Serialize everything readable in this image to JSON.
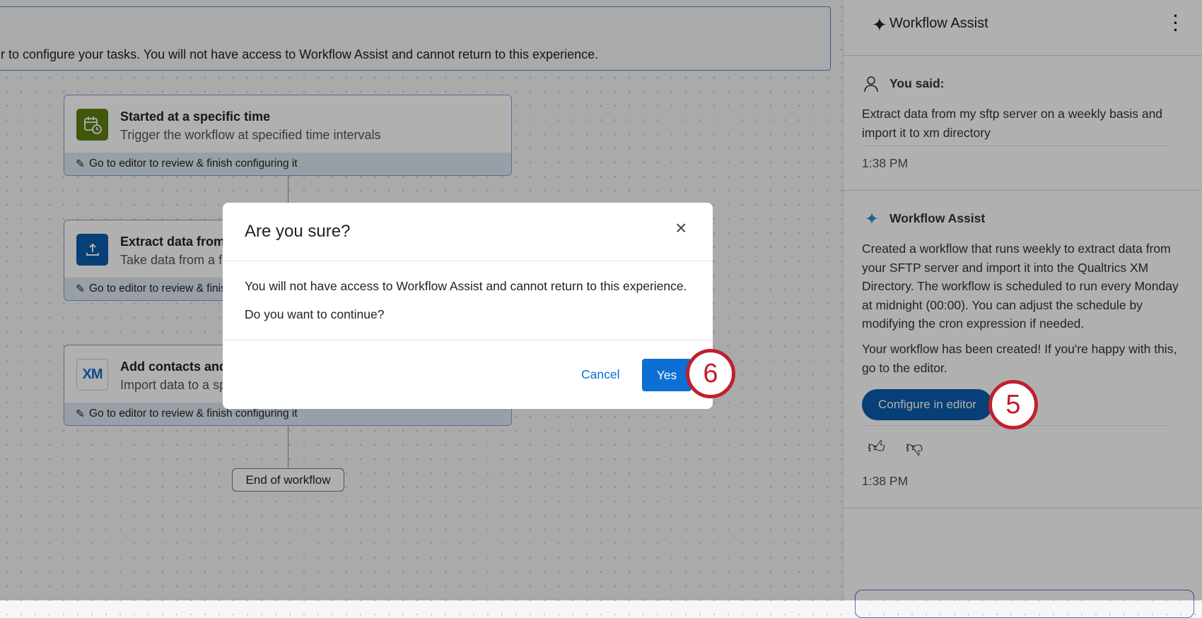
{
  "banner": {
    "text": "r to configure your tasks. You will not have access to Workflow Assist and cannot return to this experience."
  },
  "workflow": {
    "cards": [
      {
        "title": "Started at a specific time",
        "subtitle": "Trigger the workflow at specified time intervals",
        "footer": "Go to editor to review & finish configuring it",
        "icon": "calendar-clock-icon",
        "color": "#5e7e12"
      },
      {
        "title": "Extract data from",
        "subtitle": "Take data from a fi",
        "footer": "Go to editor to review & finis",
        "icon": "upload-icon",
        "color": "#0b5cad"
      },
      {
        "title": "Add contacts and",
        "subtitle": "Import data to a sp",
        "footer": "Go to editor to review & finish configuring it",
        "icon": "xm-logo-icon",
        "icon_text": "XM"
      }
    ],
    "end_label": "End of workflow"
  },
  "panel": {
    "title": "Workflow Assist",
    "user": {
      "label": "You said:",
      "message": "Extract data from my sftp server on a weekly basis and import it to xm directory",
      "time": "1:38 PM"
    },
    "assistant": {
      "label": "Workflow Assist",
      "message": "Created a workflow that runs weekly to extract data from your SFTP server and import it into the Qualtrics XM Directory. The workflow is scheduled to run every Monday at midnight (00:00). You can adjust the schedule by modifying the cron expression if needed.",
      "message2": "Your workflow has been created! If you're happy with this, go to the editor.",
      "button": "Configure in editor",
      "time": "1:38 PM"
    }
  },
  "modal": {
    "title": "Are you sure?",
    "body": "You will not have access to Workflow Assist and cannot return to this experience.",
    "question": "Do you want to continue?",
    "cancel": "Cancel",
    "confirm": "Yes"
  },
  "callouts": {
    "step5": "5",
    "step6": "6"
  },
  "colors": {
    "primary": "#0b6fd4",
    "button_dark": "#0b5cad",
    "callout": "#c0202e"
  }
}
